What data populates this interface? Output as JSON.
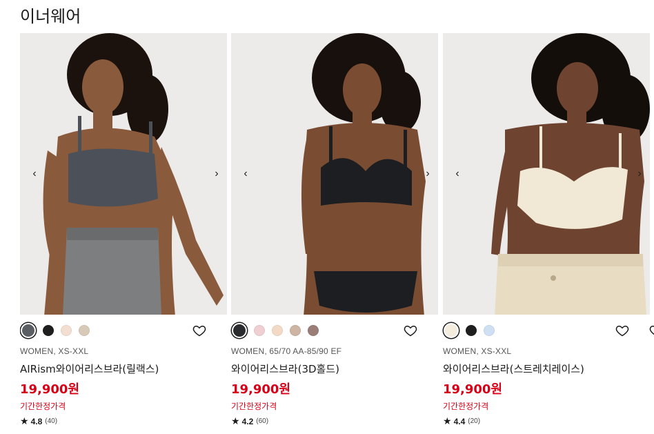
{
  "section": {
    "title": "이너웨어"
  },
  "products": [
    {
      "gender_size": "WOMEN, XS-XXL",
      "name": "AIRism와이어리스브라(릴랙스)",
      "price": "19,900원",
      "promo": "기간한정가격",
      "rating": "4.8",
      "reviews": "(40)",
      "swatches": [
        "#5b5f64",
        "#1e1e1e",
        "#f3dfd2",
        "#d9c9b8"
      ],
      "selected_swatch": 0,
      "image": {
        "bg": "#ecebea",
        "skin": "#8a5a3c",
        "hair": "#1b120d",
        "top": "#4c5058",
        "bottom": "#7d7e80"
      }
    },
    {
      "gender_size": "WOMEN, 65/70 AA-85/90 EF",
      "name": "와이어리스브라(3D홀드)",
      "price": "19,900원",
      "promo": "기간한정가격",
      "rating": "4.2",
      "reviews": "(60)",
      "swatches": [
        "#2a2b2e",
        "#efcfd2",
        "#f2dac6",
        "#cdb4a3",
        "#9b7d78"
      ],
      "selected_swatch": 0,
      "image": {
        "bg": "#ecebea",
        "skin": "#7a4d33",
        "hair": "#17100c",
        "top": "#1d1e22",
        "bottom": "#1d1e22"
      }
    },
    {
      "gender_size": "WOMEN, XS-XXL",
      "name": "와이어리스브라(스트레치레이스)",
      "price": "19,900원",
      "promo": "기간한정가격",
      "rating": "4.4",
      "reviews": "(20)",
      "swatches": [
        "#f4ecdc",
        "#1e1e1e",
        "#cfe0f5"
      ],
      "selected_swatch": 0,
      "image": {
        "bg": "#ecebea",
        "skin": "#6e4430",
        "hair": "#140e0b",
        "top": "#f1e8d6",
        "bottom": "#e8dcc2"
      }
    }
  ],
  "icons": {
    "prev": "chevron-left-icon",
    "next": "chevron-right-icon",
    "favorite": "heart-icon",
    "star": "star-icon"
  },
  "glyphs": {
    "prev": "‹",
    "next": "›",
    "star": "★"
  }
}
